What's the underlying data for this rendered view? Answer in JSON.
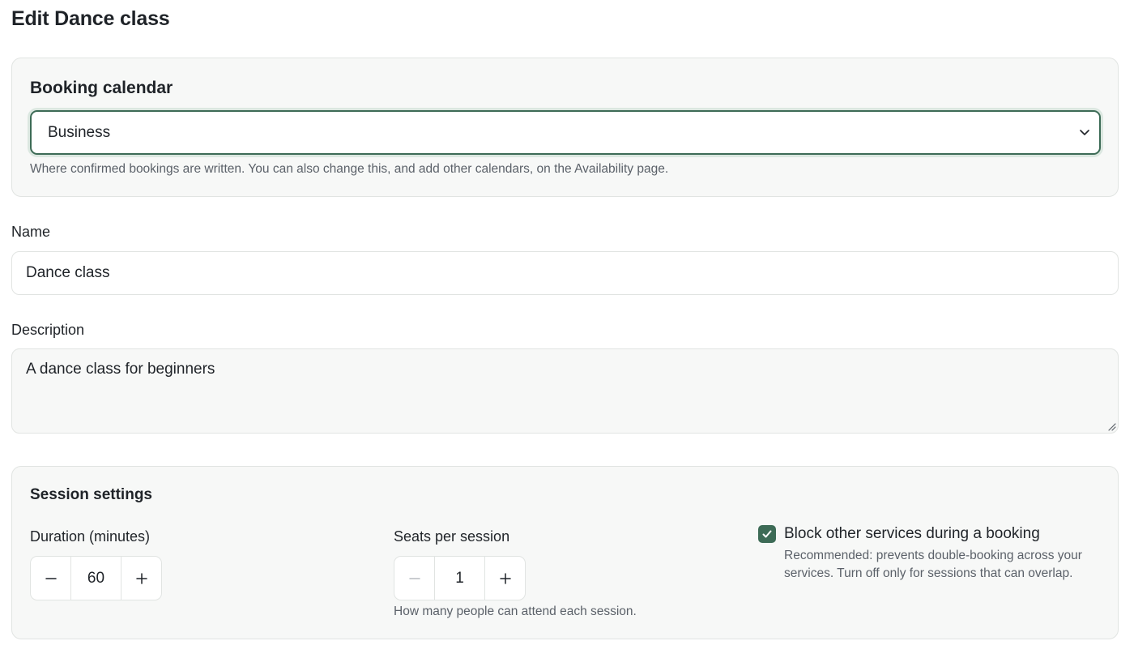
{
  "page": {
    "title": "Edit Dance class"
  },
  "booking_calendar": {
    "title": "Booking calendar",
    "selected_value": "Business",
    "help_text": "Where confirmed bookings are written. You can also change this, and add other calendars, on the Availability page."
  },
  "name_field": {
    "label": "Name",
    "value": "Dance class"
  },
  "description_field": {
    "label": "Description",
    "value": "A dance class for beginners"
  },
  "session_settings": {
    "title": "Session settings",
    "duration": {
      "label": "Duration (minutes)",
      "value": "60"
    },
    "seats": {
      "label": "Seats per session",
      "value": "1",
      "help_text": "How many people can attend each session."
    },
    "block_other_services": {
      "label": "Block other services during a booking",
      "checked": true,
      "help_text": "Recommended: prevents double-booking across your services. Turn off only for sessions that can overlap."
    }
  },
  "colors": {
    "accent": "#3d6b56",
    "card_background": "#f7f8f7",
    "border": "#e1e4e2",
    "muted_text": "#5b6169"
  }
}
